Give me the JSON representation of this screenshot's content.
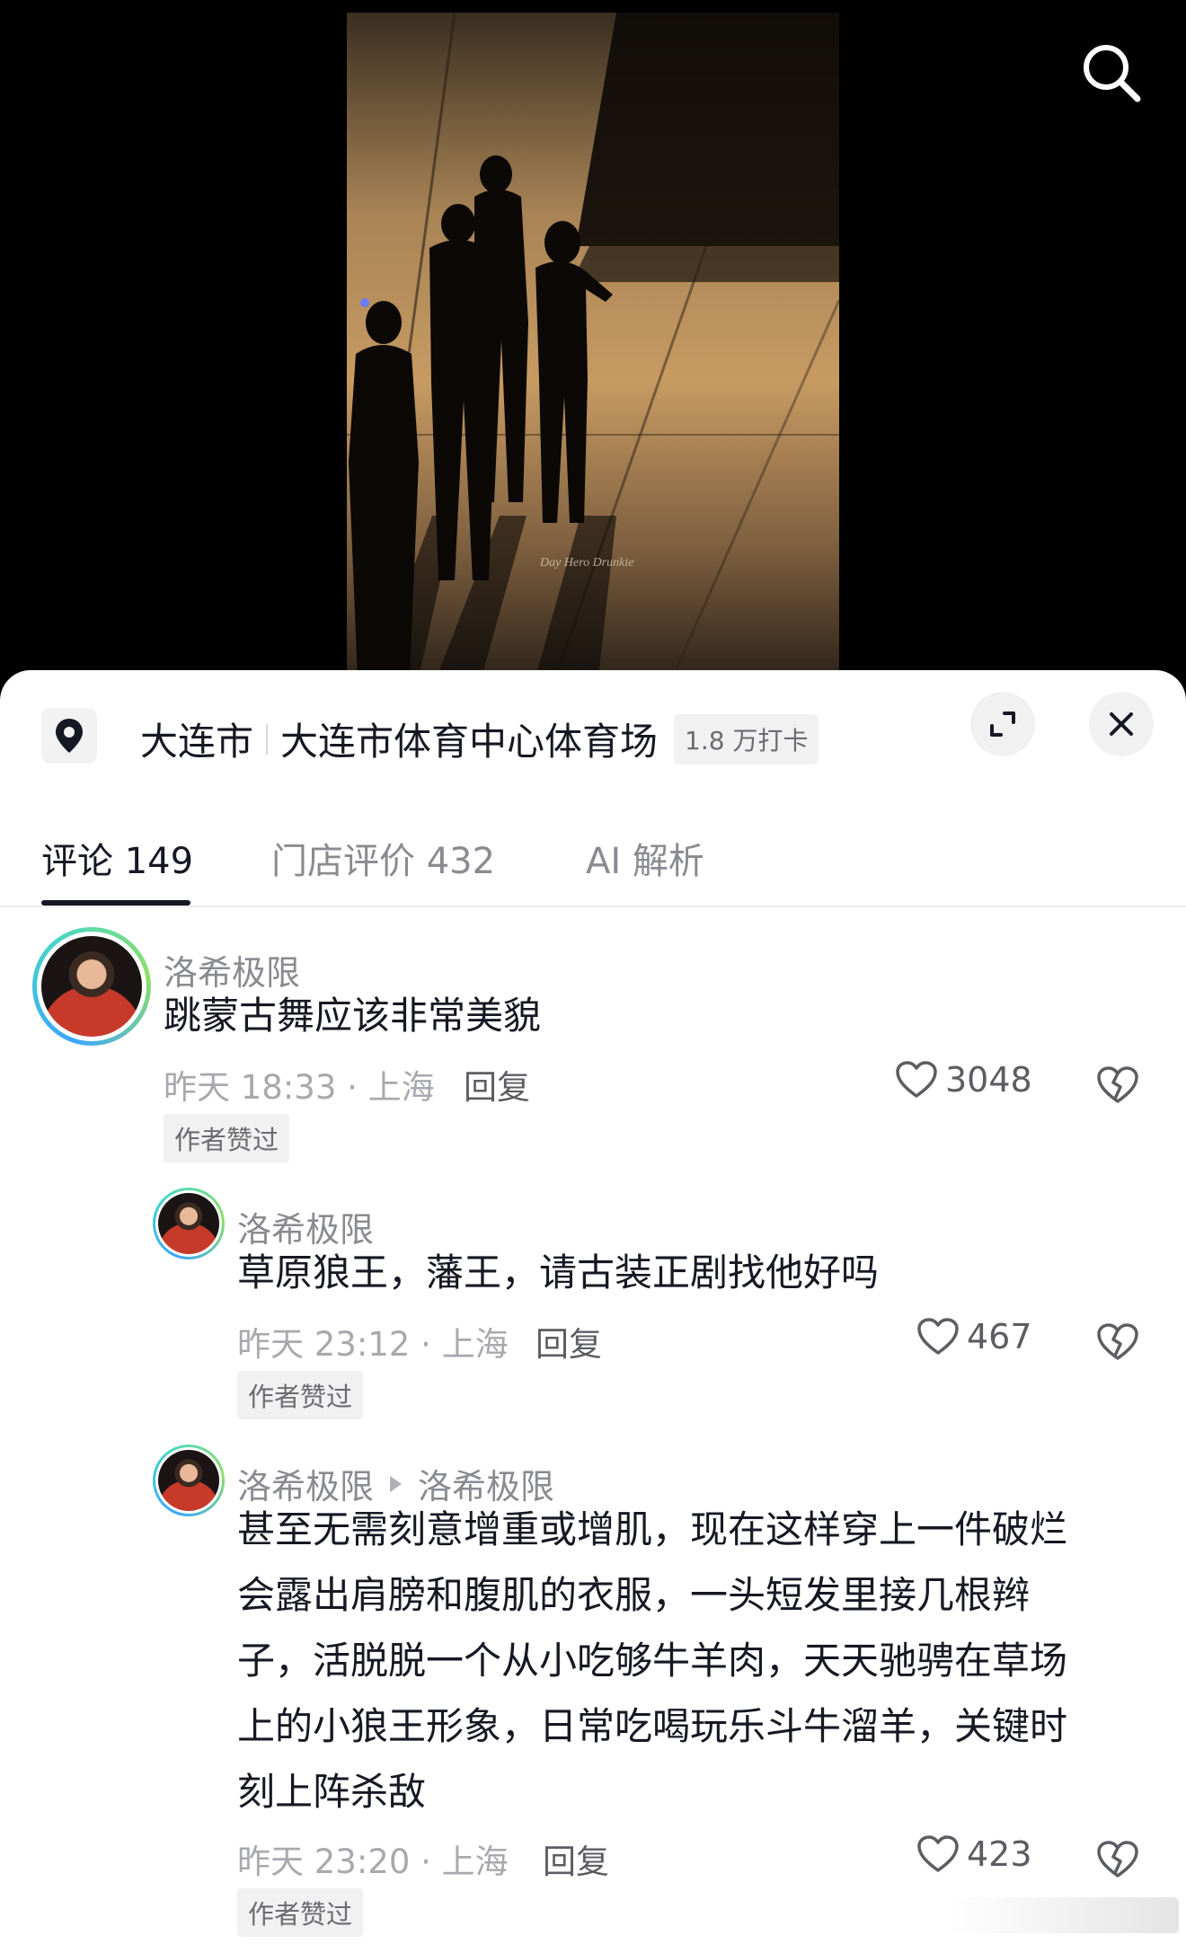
{
  "video": {
    "watermark_text": "Day Hero Drunkie"
  },
  "location": {
    "city": "大连市",
    "venue": "大连市体育中心体育场",
    "checkins": "1.8 万打卡"
  },
  "tabs": [
    {
      "label": "评论 149"
    },
    {
      "label": "门店评价 432"
    },
    {
      "label": "AI 解析"
    }
  ],
  "comments": [
    {
      "username": "洛希极限",
      "text": "跳蒙古舞应该非常美貌",
      "time": "昨天 18:33 · 上海",
      "reply": "回复",
      "likes": "3048",
      "badge": "作者赞过"
    },
    {
      "username": "洛希极限",
      "text": "草原狼王，藩王，请古装正剧找他好吗",
      "time": "昨天 23:12 · 上海",
      "reply": "回复",
      "likes": "467",
      "badge": "作者赞过"
    },
    {
      "username": "洛希极限",
      "reply_to": "洛希极限",
      "text_lines": [
        "甚至无需刻意增重或增肌，现在这样穿上一件破烂",
        "会露出肩膀和腹肌的衣服，一头短发里接几根辫",
        "子，活脱脱一个从小吃够牛羊肉，天天驰骋在草场",
        "上的小狼王形象，日常吃喝玩乐斗牛溜羊，关键时",
        "刻上阵杀敌"
      ],
      "time": "昨天 23:20 · 上海",
      "reply": "回复",
      "likes": "423",
      "badge": "作者赞过"
    }
  ],
  "colors": {
    "text_primary": "#161823",
    "text_secondary": "#8a8b91",
    "avatar_ring": "#47d6c8"
  },
  "icons": {
    "search": "search-icon",
    "location": "location-pin-icon",
    "expand": "expand-icon",
    "close": "close-icon",
    "like": "heart-icon",
    "dislike": "broken-heart-icon"
  }
}
